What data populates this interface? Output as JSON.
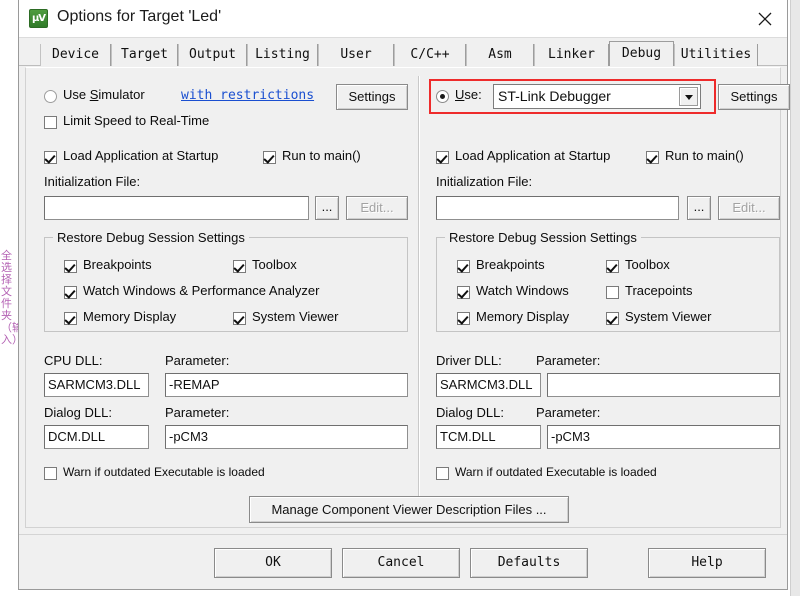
{
  "window": {
    "title": "Options for Target 'Led'",
    "icon": "uvision-logo-icon",
    "close": "×"
  },
  "tabs": [
    {
      "label": "Device",
      "active": false
    },
    {
      "label": "Target",
      "active": false
    },
    {
      "label": "Output",
      "active": false
    },
    {
      "label": "Listing",
      "active": false
    },
    {
      "label": "User",
      "active": false
    },
    {
      "label": "C/C++",
      "active": false
    },
    {
      "label": "Asm",
      "active": false
    },
    {
      "label": "Linker",
      "active": false
    },
    {
      "label": "Debug",
      "active": true
    },
    {
      "label": "Utilities",
      "active": false
    }
  ],
  "left": {
    "use_simulator_label": "Use Simulator",
    "use_simulator_checked": true,
    "restrictions_link": "with restrictions",
    "settings_button": "Settings",
    "limit_speed_label": "Limit Speed to Real-Time",
    "limit_speed_checked": false,
    "load_app_label": "Load Application at Startup",
    "load_app_checked": true,
    "run_to_main_label": "Run to main()",
    "run_to_main_checked": true,
    "init_file_label": "Initialization File:",
    "init_file_value": "",
    "browse_button": "...",
    "edit_button": "Edit...",
    "edit_button_enabled": false,
    "group_title": "Restore Debug Session Settings",
    "restore": [
      {
        "label": "Breakpoints",
        "checked": true
      },
      {
        "label": "Toolbox",
        "checked": true
      },
      {
        "label": "Watch Windows & Performance Analyzer",
        "checked": true
      },
      {
        "label": "Memory Display",
        "checked": true
      },
      {
        "label": "System Viewer",
        "checked": true
      }
    ],
    "cpu_dll_label": "CPU DLL:",
    "cpu_dll_value": "SARMCM3.DLL",
    "cpu_param_label": "Parameter:",
    "cpu_param_value": "-REMAP",
    "dialog_dll_label": "Dialog DLL:",
    "dialog_dll_value": "DCM.DLL",
    "dialog_param_label": "Parameter:",
    "dialog_param_value": "-pCM3",
    "warn_label": "Warn if outdated Executable is loaded",
    "warn_checked": false
  },
  "right": {
    "use_label": "Use:",
    "use_selected": true,
    "debugger_value": "ST-Link Debugger",
    "settings_button": "Settings",
    "load_app_label": "Load Application at Startup",
    "load_app_checked": true,
    "run_to_main_label": "Run to main()",
    "run_to_main_checked": true,
    "init_file_label": "Initialization File:",
    "init_file_value": "",
    "browse_button": "...",
    "edit_button": "Edit...",
    "edit_button_enabled": false,
    "group_title": "Restore Debug Session Settings",
    "restore": [
      {
        "label": "Breakpoints",
        "checked": true
      },
      {
        "label": "Toolbox",
        "checked": true
      },
      {
        "label": "Watch Windows",
        "checked": true
      },
      {
        "label": "Tracepoints",
        "checked": false
      },
      {
        "label": "Memory Display",
        "checked": true
      },
      {
        "label": "System Viewer",
        "checked": true
      }
    ],
    "driver_dll_label": "Driver DLL:",
    "driver_dll_value": "SARMCM3.DLL",
    "driver_param_label": "Parameter:",
    "driver_param_value": "",
    "dialog_dll_label": "Dialog DLL:",
    "dialog_dll_value": "TCM.DLL",
    "dialog_param_label": "Parameter:",
    "dialog_param_value": "-pCM3",
    "warn_label": "Warn if outdated Executable is loaded",
    "warn_checked": false
  },
  "manage_button": "Manage Component Viewer Description Files ...",
  "footer": {
    "ok": "OK",
    "cancel": "Cancel",
    "defaults": "Defaults",
    "help": "Help"
  },
  "annotation": {
    "highlight_color": "#ee2b2b"
  },
  "backdrop": {
    "cjk_text": "全选择文件夹（输入）"
  }
}
